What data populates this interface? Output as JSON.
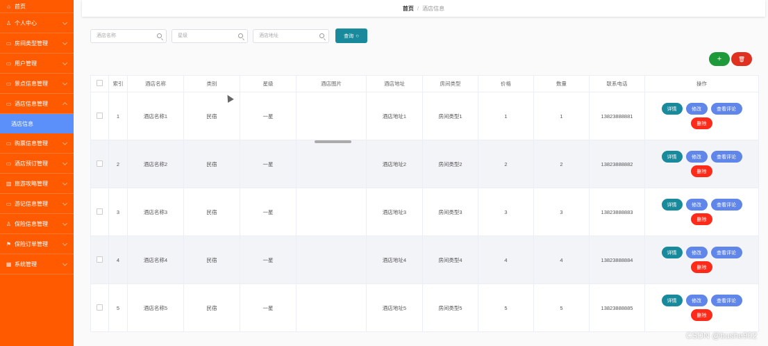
{
  "sidebar": {
    "items": [
      {
        "label": "首页",
        "icon": "home-icon"
      },
      {
        "label": "个人中心",
        "icon": "user-icon"
      },
      {
        "label": "房间类型管理",
        "icon": "folder-icon"
      },
      {
        "label": "用户管理",
        "icon": "folder-icon"
      },
      {
        "label": "景点信息管理",
        "icon": "folder-icon"
      },
      {
        "label": "酒店信息管理",
        "icon": "folder-icon"
      },
      {
        "label": "酒店信息",
        "icon": ""
      },
      {
        "label": "购票信息管理",
        "icon": "folder-icon"
      },
      {
        "label": "酒店预订管理",
        "icon": "folder-icon"
      },
      {
        "label": "旅游攻略管理",
        "icon": "chart-icon"
      },
      {
        "label": "游记信息管理",
        "icon": "folder-icon"
      },
      {
        "label": "保险信息管理",
        "icon": "user-icon"
      },
      {
        "label": "保险订单管理",
        "icon": "flag-icon"
      },
      {
        "label": "系统管理",
        "icon": "grid-icon"
      }
    ]
  },
  "breadcrumb": {
    "home": "首页",
    "separator": "/",
    "current": "酒店信息"
  },
  "search": {
    "name_placeholder": "酒店名称",
    "star_placeholder": "星级",
    "address_placeholder": "酒店地址",
    "query_label": "查询"
  },
  "toolbar": {
    "add_label": "+"
  },
  "table": {
    "headers": [
      "索引",
      "酒店名称",
      "类别",
      "星级",
      "酒店图片",
      "酒店地址",
      "房间类型",
      "价格",
      "数量",
      "联系电话",
      "操作"
    ],
    "rows": [
      {
        "index": "1",
        "name": "酒店名称1",
        "category": "民宿",
        "star": "一星",
        "address": "酒店地址1",
        "room_type": "房间类型1",
        "price": "1",
        "quantity": "1",
        "phone": "13823888881"
      },
      {
        "index": "2",
        "name": "酒店名称2",
        "category": "民宿",
        "star": "一星",
        "address": "酒店地址2",
        "room_type": "房间类型2",
        "price": "2",
        "quantity": "2",
        "phone": "13823888882"
      },
      {
        "index": "3",
        "name": "酒店名称3",
        "category": "民宿",
        "star": "一星",
        "address": "酒店地址3",
        "room_type": "房间类型3",
        "price": "3",
        "quantity": "3",
        "phone": "13823888883"
      },
      {
        "index": "4",
        "name": "酒店名称4",
        "category": "民宿",
        "star": "一星",
        "address": "酒店地址4",
        "room_type": "房间类型4",
        "price": "4",
        "quantity": "4",
        "phone": "13823888884"
      },
      {
        "index": "5",
        "name": "酒店名称5",
        "category": "民宿",
        "star": "一星",
        "address": "酒店地址5",
        "room_type": "房间类型5",
        "price": "5",
        "quantity": "5",
        "phone": "13823888885"
      }
    ],
    "actions": {
      "detail": "详情",
      "edit": "修改",
      "review": "查看评论",
      "delete": "删除"
    }
  },
  "watermark": "CSDN @bushe902"
}
